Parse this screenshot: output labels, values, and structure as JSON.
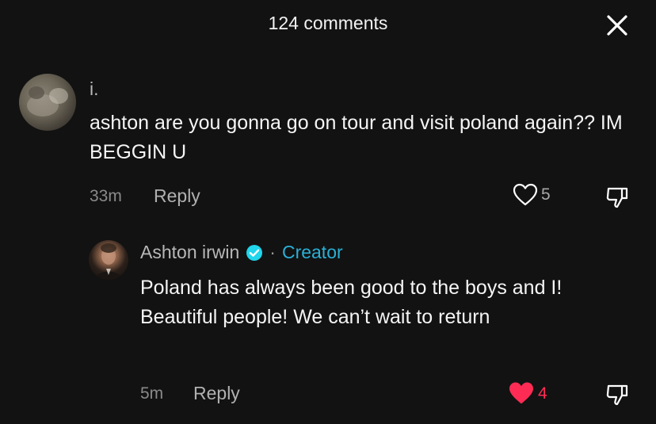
{
  "header": {
    "title": "124 comments"
  },
  "comments": [
    {
      "username": "i.",
      "text": "ashton are you gonna go on tour and visit poland again?? IM BEGGIN U",
      "time": "33m",
      "reply_label": "Reply",
      "likes": "5",
      "liked": false
    },
    {
      "username": "Ashton irwin",
      "badge": "Creator",
      "text": "Poland has always been good to the boys and I! Beautiful people! We can’t wait to return",
      "time": "5m",
      "reply_label": "Reply",
      "likes": "4",
      "liked": true
    }
  ],
  "colors": {
    "background": "#121212",
    "like_active": "#fe2c55",
    "creator_badge": "#2ab0d6",
    "verified": "#20d5ec"
  }
}
